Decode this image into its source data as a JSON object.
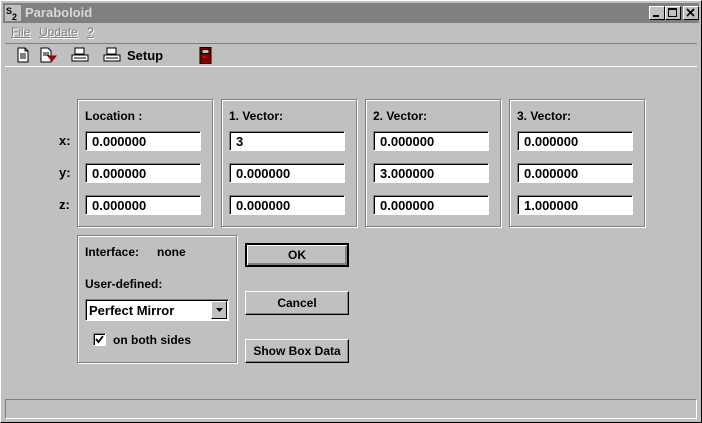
{
  "window": {
    "title": "Paraboloid",
    "controls": [
      "minimize-icon",
      "maximize-icon",
      "close-icon"
    ]
  },
  "menu": {
    "file": "File",
    "update": "Update",
    "help": "?"
  },
  "toolbar": {
    "setup_label": "Setup",
    "icons": [
      "new-document-icon",
      "save-document-icon",
      "print-icon",
      "print-setup-icon",
      "exit-door-icon"
    ]
  },
  "axes": {
    "x": "x:",
    "y": "y:",
    "z": "z:"
  },
  "groups": {
    "location": {
      "label": "Location :",
      "x": "0.000000",
      "y": "0.000000",
      "z": "0.000000"
    },
    "vector1": {
      "label": "1. Vector:",
      "x": "3",
      "y": "0.000000",
      "z": "0.000000"
    },
    "vector2": {
      "label": "2. Vector:",
      "x": "0.000000",
      "y": "3.000000",
      "z": "0.000000"
    },
    "vector3": {
      "label": "3. Vector:",
      "x": "0.000000",
      "y": "0.000000",
      "z": "1.000000"
    }
  },
  "interface": {
    "label": "Interface:",
    "value": "none",
    "user_defined_label": "User-defined:",
    "selected": "Perfect Mirror",
    "checkbox_label": "on both sides",
    "checkbox_checked": true
  },
  "buttons": {
    "ok": "OK",
    "cancel": "Cancel",
    "show_box_data": "Show Box Data"
  },
  "colors": {
    "face": "#c0c0c0",
    "titlebar_inactive": "#808080"
  }
}
